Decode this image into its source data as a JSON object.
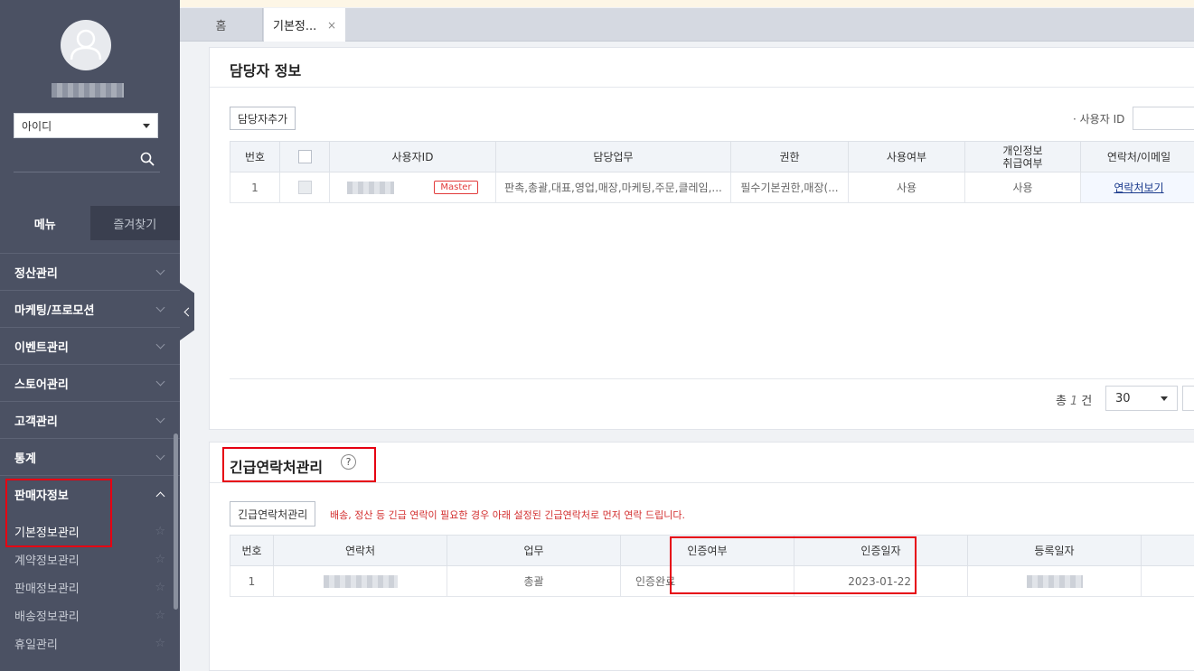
{
  "sidebar": {
    "id_select": "아이디",
    "tabs": [
      "메뉴",
      "즐겨찾기"
    ],
    "menu": [
      "정산관리",
      "마케팅/프로모션",
      "이벤트관리",
      "스토어관리",
      "고객관리",
      "통계"
    ],
    "open_menu": "판매자정보",
    "sub_items": [
      "기본정보관리",
      "계약정보관리",
      "판매정보관리",
      "배송정보관리",
      "휴일관리"
    ]
  },
  "tabs": {
    "home": "홈",
    "active": "기본정...",
    "close": "×"
  },
  "section1": {
    "title": "담당자 정보",
    "add_button": "담당자추가",
    "filter_label": "· 사용자 ID",
    "columns": [
      "번호",
      "",
      "사용자ID",
      "담당업무",
      "권한",
      "사용여부",
      "개인정보\n취급여부",
      "연락처/이메일"
    ],
    "row": {
      "no": "1",
      "badge": "Master",
      "duties": "판촉,총괄,대표,영업,매장,마케팅,주문,클레임,...",
      "auth": "필수기본권한,매장(...",
      "use": "사용",
      "privacy": "사용",
      "contact": "연락처보기"
    },
    "total_prefix": "총",
    "total_count": "1",
    "total_suffix": "건",
    "page_size": "30"
  },
  "section2": {
    "title": "긴급연락처관리",
    "help": "?",
    "button": "긴급연락처관리",
    "notice": "배송, 정산 등 긴급 연락이 필요한 경우 아래 설정된 긴급연락처로 먼저 연락 드립니다.",
    "columns": [
      "번호",
      "연락처",
      "업무",
      "인증여부",
      "인증일자",
      "등록일자",
      ""
    ],
    "row": {
      "no": "1",
      "duty": "총괄",
      "auth": "인증완료",
      "auth_date": "2023-01-22"
    }
  }
}
